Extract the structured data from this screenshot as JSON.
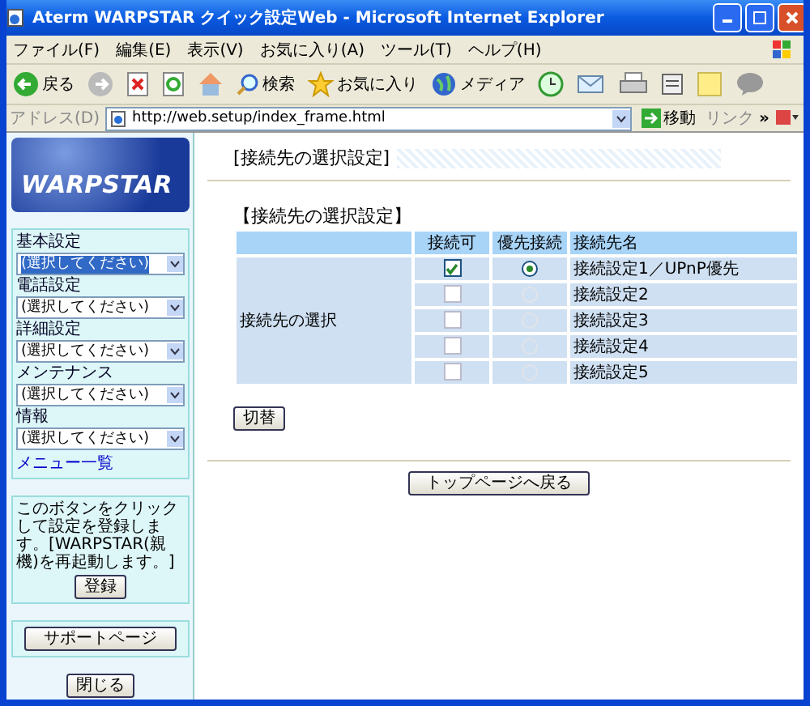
{
  "window": {
    "title": "Aterm WARPSTAR クイック設定Web - Microsoft Internet Explorer"
  },
  "menu": [
    "ファイル(F)",
    "編集(E)",
    "表示(V)",
    "お気に入り(A)",
    "ツール(T)",
    "ヘルプ(H)"
  ],
  "toolbar": {
    "back": "戻る",
    "search": "検索",
    "favorites": "お気に入り",
    "media": "メディア"
  },
  "address": {
    "label": "アドレス(D)",
    "url": "http://web.setup/index_frame.html",
    "go": "移動",
    "links": "リンク",
    "more": "»"
  },
  "sidebar": {
    "logo": "WARPSTAR",
    "sections": [
      {
        "label": "基本設定",
        "value": "(選択してください)",
        "selected": true
      },
      {
        "label": "電話設定",
        "value": "(選択してください)",
        "selected": false
      },
      {
        "label": "詳細設定",
        "value": "(選択してください)",
        "selected": false
      },
      {
        "label": "メンテナンス",
        "value": "(選択してください)",
        "selected": false
      },
      {
        "label": "情報",
        "value": "(選択してください)",
        "selected": false
      }
    ],
    "menu_link": "メニュー一覧",
    "note": "このボタンをクリックして設定を登録します。[WARPSTAR(親機)を再起動します。]",
    "register": "登録",
    "support": "サポートページ",
    "close": "閉じる"
  },
  "main": {
    "title": "[接続先の選択設定]",
    "section": "【接続先の選択設定】",
    "columns": [
      "接続可",
      "優先接続",
      "接続先名"
    ],
    "row_header": "接続先の選択",
    "rows": [
      {
        "name": "接続設定1／UPnP優先",
        "checked": true,
        "selected": true,
        "disabled": false
      },
      {
        "name": "接続設定2",
        "checked": false,
        "selected": false,
        "disabled": true
      },
      {
        "name": "接続設定3",
        "checked": false,
        "selected": false,
        "disabled": true
      },
      {
        "name": "接続設定4",
        "checked": false,
        "selected": false,
        "disabled": true
      },
      {
        "name": "接続設定5",
        "checked": false,
        "selected": false,
        "disabled": true
      }
    ],
    "switch": "切替",
    "back_top": "トップページへ戻る"
  }
}
